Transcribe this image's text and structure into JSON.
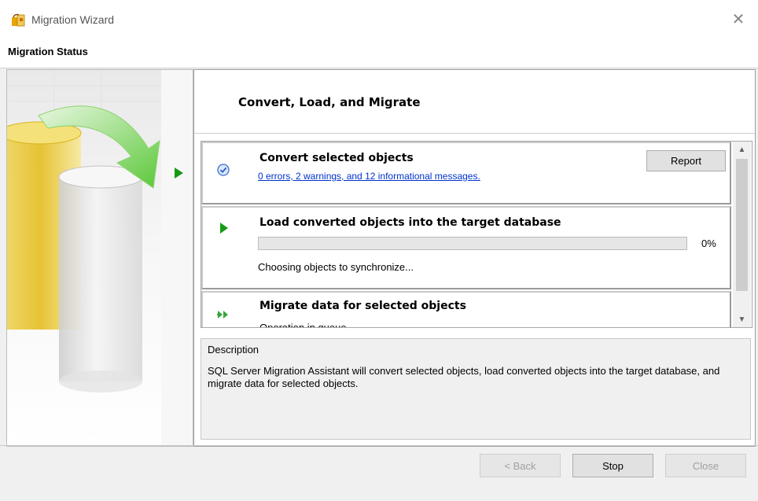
{
  "window": {
    "title": "Migration Wizard",
    "close_glyph": "✕",
    "icon": "migration-wizard-icon"
  },
  "header": {
    "title": "Migration Status"
  },
  "step": {
    "title": "Convert, Load, and Migrate"
  },
  "tasks": [
    {
      "name": "Convert selected objects",
      "link": "0 errors, 2 warnings, and 12 informational messages.",
      "button": "Report",
      "icon": "check-circle-icon"
    },
    {
      "name": "Load converted objects into the target database",
      "progress_percent": 0,
      "progress_label": "0%",
      "status": "Choosing objects to synchronize...",
      "icon": "play-icon"
    },
    {
      "name": "Migrate data for selected objects",
      "status": "Operation in queue",
      "icon": "double-arrow-icon"
    }
  ],
  "description": {
    "label": "Description",
    "text": "SQL Server Migration Assistant will convert selected objects, load converted objects into the target database, and migrate data for selected objects."
  },
  "buttons": {
    "back": "< Back",
    "stop": "Stop",
    "close": "Close"
  },
  "colors": {
    "accent_green": "#169a16",
    "link": "#0033cc",
    "progress_fill": "#06b025"
  }
}
